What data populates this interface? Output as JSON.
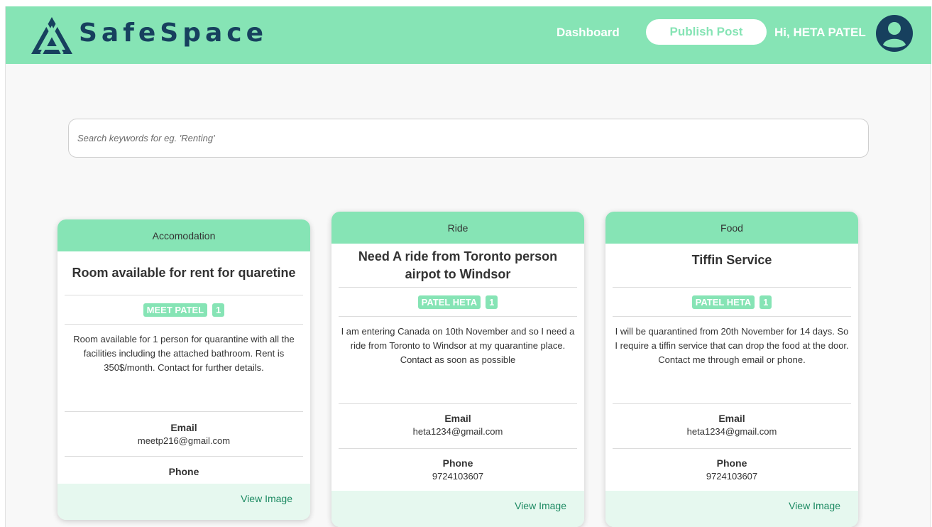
{
  "navbar": {
    "brand": "SafeSpace",
    "dashboard_link": "Dashboard",
    "publish_button": "Publish Post",
    "greeting": "Hi, HETA PATEL",
    "avatar_icon": "user-circle-icon"
  },
  "search": {
    "placeholder": "Search keywords for eg. 'Renting'",
    "value": ""
  },
  "labels": {
    "email": "Email",
    "phone": "Phone",
    "view_image": "View Image"
  },
  "posts": [
    {
      "category": "Accomodation",
      "title": "Room available for rent for quaretine",
      "author": "MEET PATEL",
      "count": "1",
      "description": "Room available for 1 person for quarantine with all the facilities including the attached bathroom. Rent is 350$/month. Contact for further details.",
      "email": "meetp216@gmail.com",
      "phone": ""
    },
    {
      "category": "Ride",
      "title": "Need A ride from Toronto person airpot to Windsor",
      "author": "PATEL HETA",
      "count": "1",
      "description": "I am entering Canada on 10th November and so I need a ride from Toronto to Windsor at my quarantine place. Contact as soon as possible",
      "email": "heta1234@gmail.com",
      "phone": "9724103607"
    },
    {
      "category": "Food",
      "title": "Tiffin Service",
      "author": "PATEL HETA",
      "count": "1",
      "description": "I will be quarantined from 20th November for 14 days. So I require a tiffin service that can drop the food at the door. Contact me through email or phone.",
      "email": "heta1234@gmail.com",
      "phone": "9724103607"
    }
  ],
  "colors": {
    "accent": "#86e4b5",
    "brand_text": "#17405e",
    "footer_bg": "#e6f8ef",
    "link": "#1c8a62"
  }
}
